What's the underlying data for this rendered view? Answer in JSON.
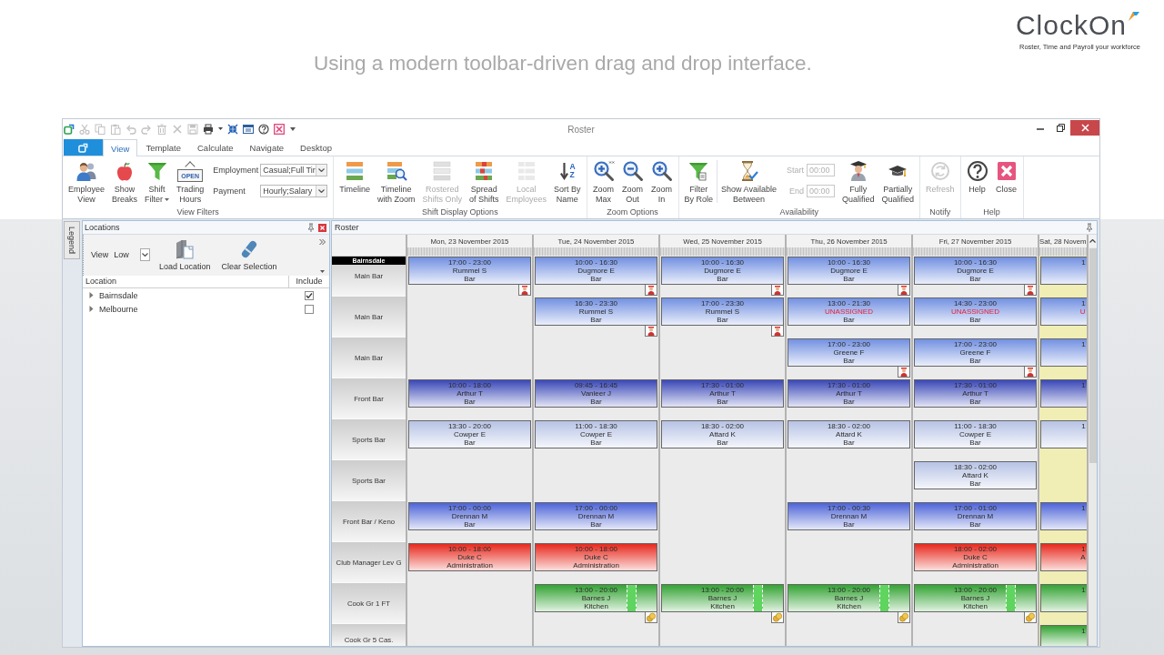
{
  "banner": {
    "caption": "Using a modern toolbar-driven drag and drop interface.",
    "logo": "ClockOn",
    "tagline": "Roster, Time and Payroll your workforce"
  },
  "window": {
    "title": "Roster",
    "quick_access": [
      {
        "disabled": false
      },
      {
        "disabled": true
      },
      {
        "disabled": true
      },
      {
        "disabled": true
      },
      {
        "disabled": true
      },
      {
        "disabled": true
      },
      {
        "disabled": true
      },
      {
        "disabled": true
      },
      {
        "disabled": true
      },
      {
        "disabled": false
      },
      {
        "disabled": false
      },
      {
        "disabled": false
      },
      {
        "disabled": false
      },
      {
        "disabled": false
      },
      {
        "disabled": false
      }
    ]
  },
  "tabs": [
    {
      "label": "View",
      "selected": true
    },
    {
      "label": "Template",
      "selected": false
    },
    {
      "label": "Calculate",
      "selected": false
    },
    {
      "label": "Navigate",
      "selected": false
    },
    {
      "label": "Desktop",
      "selected": false
    }
  ],
  "ribbon": [
    {
      "label": "View Filters",
      "items": [
        {
          "kind": "button",
          "label": "Employee\nView",
          "disabled": false
        },
        {
          "kind": "button",
          "label": "Show\nBreaks",
          "disabled": false
        },
        {
          "kind": "button",
          "label": "Shift\nFilter",
          "dropdown": true,
          "disabled": false
        },
        {
          "kind": "button",
          "label": "Trading\nHours",
          "icon_text": "OPEN",
          "disabled": false
        },
        {
          "kind": "fields",
          "fields": [
            {
              "kind": "combo",
              "label": "Employment",
              "value": "Casual;Full Tir",
              "disabled": false
            },
            {
              "kind": "combo",
              "label": "Payment",
              "value": "Hourly;Salary",
              "disabled": false
            }
          ]
        }
      ]
    },
    {
      "label": "Shift Display Options",
      "items": [
        {
          "kind": "button",
          "label": "Timeline",
          "disabled": false
        },
        {
          "kind": "button",
          "label": "Timeline\nwith Zoom",
          "disabled": false
        },
        {
          "kind": "button",
          "label": "Rostered\nShifts Only",
          "disabled": true
        },
        {
          "kind": "button",
          "label": "Spread\nof Shifts",
          "disabled": false
        },
        {
          "kind": "button",
          "label": "Local\nEmployees",
          "disabled": true
        },
        {
          "kind": "button",
          "label": "Sort By\nName",
          "icon_text": "AZ",
          "disabled": false
        }
      ]
    },
    {
      "label": "Zoom Options",
      "items": [
        {
          "kind": "button",
          "label": "Zoom\nMax",
          "disabled": false
        },
        {
          "kind": "button",
          "label": "Zoom\nOut",
          "disabled": false
        },
        {
          "kind": "button",
          "label": "Zoom\nIn",
          "disabled": false
        }
      ]
    },
    {
      "label": "Availability",
      "items": [
        {
          "kind": "button",
          "label": "Filter\nBy Role",
          "disabled": false
        },
        {
          "kind": "separator"
        },
        {
          "kind": "button",
          "label": "Show Available\nBetween",
          "disabled": false
        },
        {
          "kind": "fields",
          "fields": [
            {
              "kind": "text",
              "label": "Start",
              "value": "00:00",
              "disabled": true
            },
            {
              "kind": "text",
              "label": "End",
              "value": "00:00",
              "disabled": true
            }
          ]
        },
        {
          "kind": "button",
          "label": "Fully\nQualified",
          "disabled": false
        },
        {
          "kind": "button",
          "label": "Partially\nQualified",
          "disabled": false
        }
      ]
    },
    {
      "label": "Notify",
      "items": [
        {
          "kind": "button",
          "label": "Refresh",
          "disabled": true
        }
      ]
    },
    {
      "label": "Help",
      "items": [
        {
          "kind": "button",
          "label": "Help",
          "disabled": false
        },
        {
          "kind": "button",
          "label": "Close",
          "disabled": false
        }
      ]
    }
  ],
  "legend_tab": "Legend",
  "locations": {
    "title": "Locations",
    "view_label": "View",
    "view_value": "Low",
    "buttons": [
      "Load Location",
      "Clear Selection"
    ],
    "columns": [
      "Location",
      "Include"
    ],
    "rows": [
      {
        "name": "Bairnsdale",
        "expanded": false,
        "checked": true
      },
      {
        "name": "Melbourne",
        "expanded": false,
        "checked": false
      }
    ]
  },
  "roster": {
    "title": "Roster",
    "location": "Bairnsdale",
    "days": [
      {
        "label": "Mon, 23 November 2015",
        "shaded": false
      },
      {
        "label": "Tue, 24 November 2015",
        "shaded": false
      },
      {
        "label": "Wed, 25 November 2015",
        "shaded": false
      },
      {
        "label": "Thu, 26 November 2015",
        "shaded": false
      },
      {
        "label": "Fri, 27 November 2015",
        "shaded": false
      },
      {
        "label": "Sat, 28 Novem",
        "shaded": true
      }
    ],
    "rows": [
      {
        "label": "Main Bar",
        "color": "#7391e2",
        "cells": [
          {
            "time": "17:00 - 23:00",
            "name": "Rummel S",
            "role": "Bar",
            "unassigned": false,
            "badge": {
              "kind": "qualification"
            }
          },
          {
            "time": "10:00 - 16:30",
            "name": "Dugmore E",
            "role": "Bar",
            "unassigned": false,
            "badge": {
              "kind": "qualification"
            }
          },
          {
            "time": "10:00 - 16:30",
            "name": "Dugmore E",
            "role": "Bar",
            "unassigned": false,
            "badge": {
              "kind": "qualification"
            }
          },
          {
            "time": "10:00 - 16:30",
            "name": "Dugmore E",
            "role": "Bar",
            "unassigned": false,
            "badge": {
              "kind": "qualification"
            }
          },
          {
            "time": "10:00 - 16:30",
            "name": "Dugmore E",
            "role": "Bar",
            "unassigned": false,
            "badge": {
              "kind": "qualification"
            }
          },
          {
            "time": "1"
          }
        ]
      },
      {
        "label": "Main Bar",
        "color": "#7391e2",
        "cells": [
          null,
          {
            "time": "16:30 - 23:30",
            "name": "Rummel S",
            "role": "Bar",
            "unassigned": false,
            "badge": {
              "kind": "qualification"
            }
          },
          {
            "time": "17:00 - 23:30",
            "name": "Rummel S",
            "role": "Bar",
            "unassigned": false,
            "badge": {
              "kind": "qualification"
            }
          },
          {
            "time": "13:00 - 21:30",
            "name": "UNASSIGNED",
            "role": "Bar",
            "unassigned": true
          },
          {
            "time": "14:30 - 23:00",
            "name": "UNASSIGNED",
            "role": "Bar",
            "unassigned": true
          },
          {
            "time": "1",
            "name": "U",
            "unassigned": true
          }
        ]
      },
      {
        "label": "Main Bar",
        "color": "#7391e2",
        "cells": [
          null,
          null,
          null,
          {
            "time": "17:00 - 23:00",
            "name": "Greene F",
            "role": "Bar",
            "unassigned": false,
            "badge": {
              "kind": "qualification"
            }
          },
          {
            "time": "17:00 - 23:00",
            "name": "Greene F",
            "role": "Bar",
            "unassigned": false,
            "badge": {
              "kind": "qualification"
            }
          },
          {
            "time": "1"
          }
        ]
      },
      {
        "label": "Front Bar",
        "color": "#3a48b8",
        "cells": [
          {
            "time": "10:00 - 18:00",
            "name": "Arthur T",
            "role": "Bar",
            "unassigned": false
          },
          {
            "time": "09:45 - 16:45",
            "name": "Vanleer J",
            "role": "Bar",
            "unassigned": false
          },
          {
            "time": "17:30 - 01:00",
            "name": "Arthur T",
            "role": "Bar",
            "unassigned": false
          },
          {
            "time": "17:30 - 01:00",
            "name": "Arthur T",
            "role": "Bar",
            "unassigned": false
          },
          {
            "time": "17:30 - 01:00",
            "name": "Arthur T",
            "role": "Bar",
            "unassigned": false
          },
          {
            "time": "1"
          }
        ]
      },
      {
        "label": "Sports Bar",
        "color": "#b7c3e5",
        "cells": [
          {
            "time": "13:30 - 20:00",
            "name": "Cowper E",
            "role": "Bar",
            "unassigned": false
          },
          {
            "time": "11:00 - 18:30",
            "name": "Cowper E",
            "role": "Bar",
            "unassigned": false
          },
          {
            "time": "18:30 - 02:00",
            "name": "Attard K",
            "role": "Bar",
            "unassigned": false
          },
          {
            "time": "18:30 - 02:00",
            "name": "Attard K",
            "role": "Bar",
            "unassigned": false
          },
          {
            "time": "11:00 - 18:30",
            "name": "Cowper E",
            "role": "Bar",
            "unassigned": false
          },
          {
            "time": "1"
          }
        ]
      },
      {
        "label": "Sports Bar",
        "color": "#b7c3e5",
        "cells": [
          null,
          null,
          null,
          null,
          {
            "time": "18:30 - 02:00",
            "name": "Attard K",
            "role": "Bar",
            "unassigned": false
          },
          null
        ]
      },
      {
        "label": "Front Bar / Keno",
        "color": "#4d64d8",
        "cells": [
          {
            "time": "17:00 - 00:00",
            "name": "Drennan M",
            "role": "Bar",
            "unassigned": false
          },
          {
            "time": "17:00 - 00:00",
            "name": "Drennan M",
            "role": "Bar",
            "unassigned": false
          },
          null,
          {
            "time": "17:00 - 00:30",
            "name": "Drennan M",
            "role": "Bar",
            "unassigned": false
          },
          {
            "time": "17:00 - 01:00",
            "name": "Drennan M",
            "role": "Bar",
            "unassigned": false
          },
          {
            "time": "1"
          }
        ]
      },
      {
        "label": "Club Manager Lev G",
        "color": "#e8291d",
        "cells": [
          {
            "time": "10:00 - 18:00",
            "name": "Duke C",
            "role": "Administration",
            "unassigned": false
          },
          {
            "time": "10:00 - 18:00",
            "name": "Duke C",
            "role": "Administration",
            "unassigned": false
          },
          null,
          null,
          {
            "time": "18:00 - 02:00",
            "name": "Duke C",
            "role": "Administration",
            "unassigned": false
          },
          {
            "time": "1",
            "role": "A"
          }
        ]
      },
      {
        "label": "Cook Gr 1 FT",
        "color": "#33a333",
        "cells": [
          null,
          {
            "time": "13:00 - 20:00",
            "name": "Barnes J",
            "role": "Kitchen",
            "unassigned": false,
            "badge": {
              "kind": "cost"
            },
            "break": true
          },
          {
            "time": "13:00 - 20:00",
            "name": "Barnes J",
            "role": "Kitchen",
            "unassigned": false,
            "badge": {
              "kind": "cost"
            },
            "break": true
          },
          {
            "time": "13:00 - 20:00",
            "name": "Barnes J",
            "role": "Kitchen",
            "unassigned": false,
            "badge": {
              "kind": "cost"
            },
            "break": true
          },
          {
            "time": "13:00 - 20:00",
            "name": "Barnes J",
            "role": "Kitchen",
            "unassigned": false,
            "badge": {
              "kind": "cost"
            },
            "break": true
          },
          {
            "time": "1"
          }
        ]
      },
      {
        "label": "Cook Gr 5 Cas.",
        "color": "#33a333",
        "cells": [
          null,
          null,
          null,
          null,
          null,
          {
            "time": "1"
          }
        ]
      }
    ]
  }
}
